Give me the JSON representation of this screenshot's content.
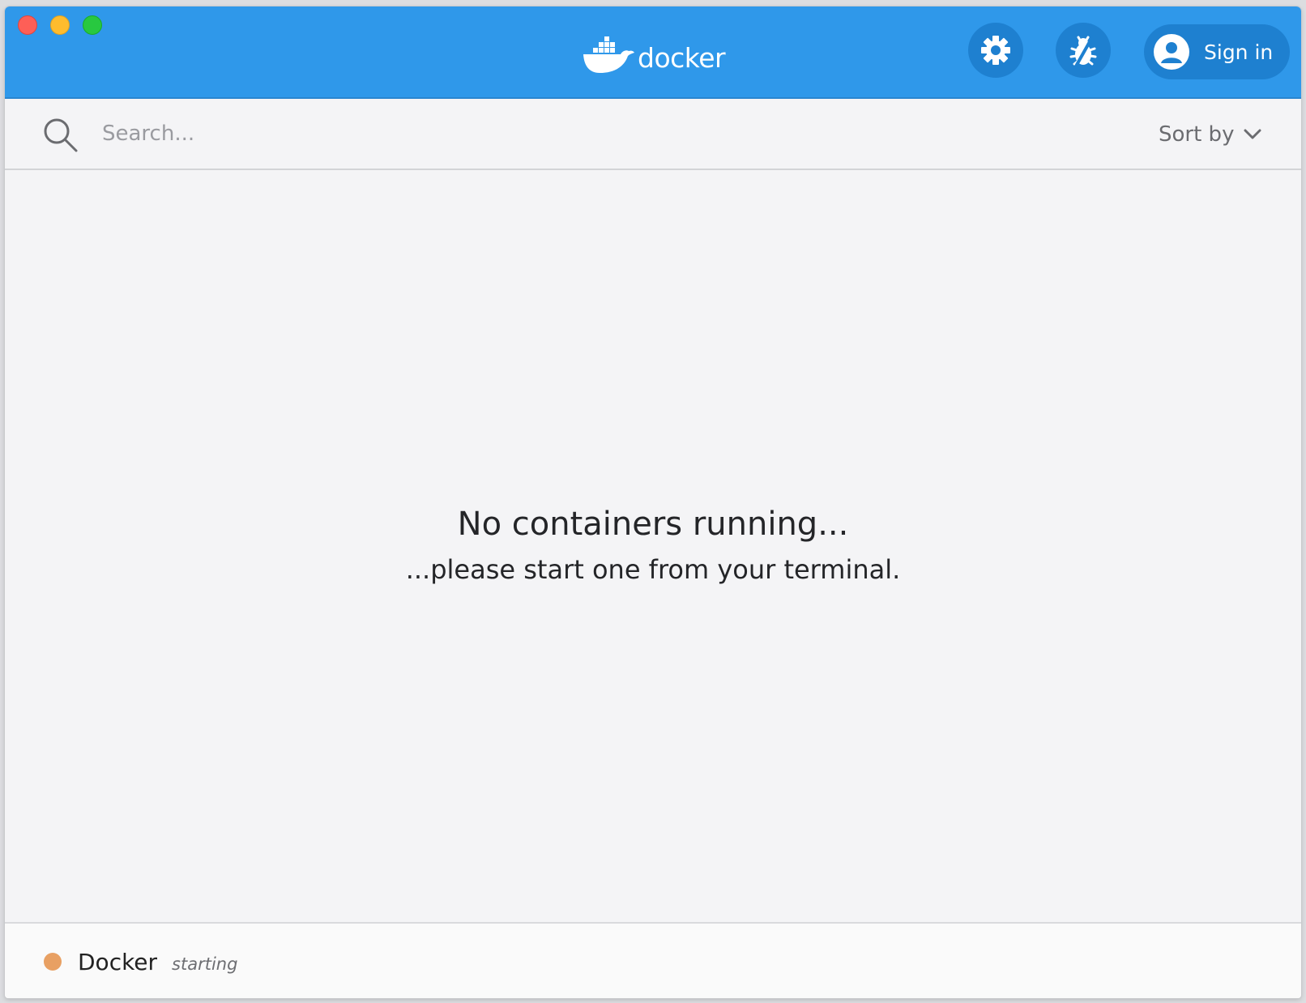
{
  "window": {
    "controls": [
      "close",
      "minimize",
      "maximize"
    ]
  },
  "header": {
    "logo_text": "docker",
    "logo_icon": "docker-whale-icon",
    "settings_icon": "gear-icon",
    "bug_icon": "bug-icon",
    "signin_label": "Sign in",
    "signin_icon": "user-icon",
    "brand_color": "#2f98ea"
  },
  "search": {
    "placeholder": "Search...",
    "value": "",
    "sort_label": "Sort by"
  },
  "main": {
    "empty_title": "No containers running...",
    "empty_subtitle": "...please start one from your terminal."
  },
  "status": {
    "name": "Docker",
    "state": "starting",
    "dot_color": "#e8a063"
  }
}
